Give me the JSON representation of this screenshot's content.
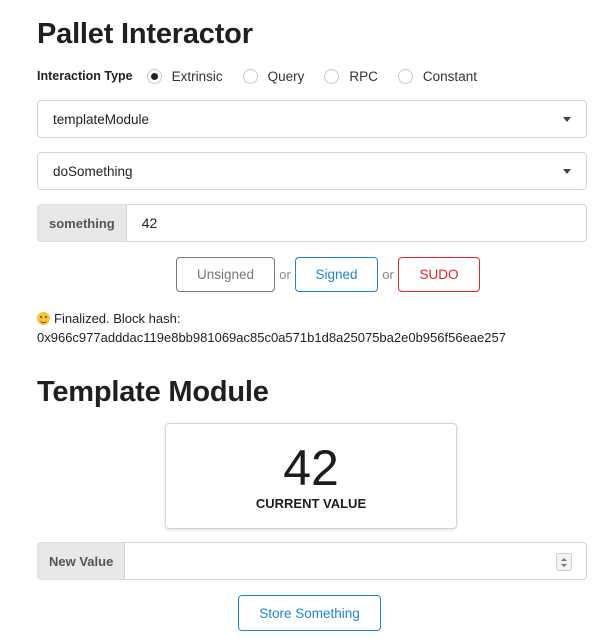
{
  "interactor": {
    "title": "Pallet Interactor",
    "interaction_type_label": "Interaction Type",
    "interaction_types": [
      {
        "label": "Extrinsic",
        "selected": true
      },
      {
        "label": "Query",
        "selected": false
      },
      {
        "label": "RPC",
        "selected": false
      },
      {
        "label": "Constant",
        "selected": false
      }
    ],
    "pallet_value": "templateModule",
    "callable_value": "doSomething",
    "param_label": "something",
    "param_value": "42",
    "buttons": {
      "unsigned": "Unsigned",
      "or": "or",
      "signed": "Signed",
      "sudo": "SUDO"
    },
    "status_line1": "Finalized. Block hash:",
    "status_hash": "0x966c977adddac119e8bb981069ac85c0a571b1d8a25075ba2e0b956f56eae257"
  },
  "template": {
    "title": "Template Module",
    "current_value": "42",
    "current_value_label": "CURRENT VALUE",
    "new_value_label": "New Value",
    "new_value": "",
    "store_button": "Store Something"
  },
  "colors": {
    "signed": "#2185d0",
    "sudo": "#db2828",
    "unsigned": "#767676"
  }
}
